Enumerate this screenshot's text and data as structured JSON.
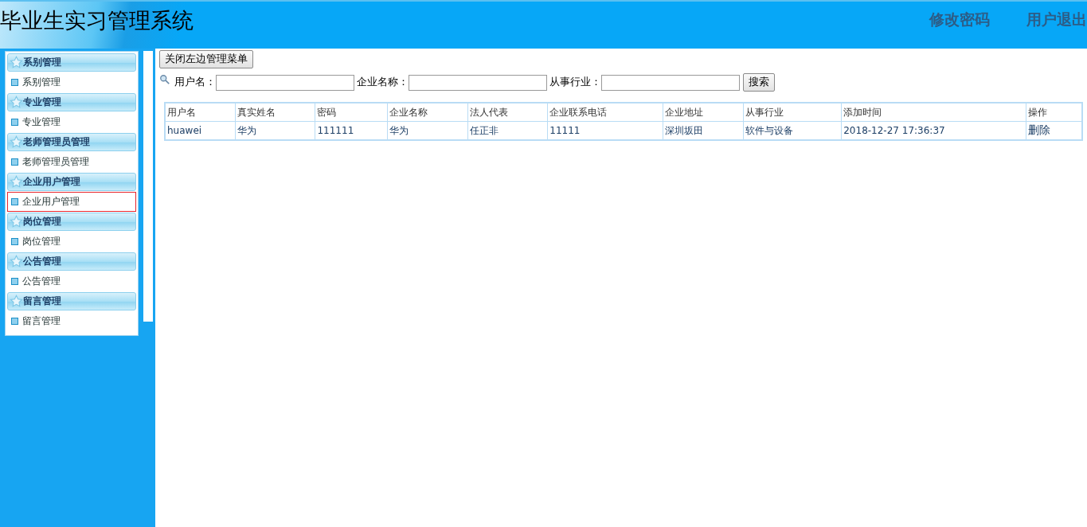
{
  "header": {
    "title": "毕业生实习管理系统",
    "links": [
      "修改密码",
      "用户退出"
    ]
  },
  "sidebar": {
    "sections": [
      {
        "title": "系别管理",
        "items": [
          {
            "label": "系别管理",
            "selected": false
          }
        ]
      },
      {
        "title": "专业管理",
        "items": [
          {
            "label": "专业管理",
            "selected": false
          }
        ]
      },
      {
        "title": "老师管理员管理",
        "items": [
          {
            "label": "老师管理员管理",
            "selected": false
          }
        ]
      },
      {
        "title": "企业用户管理",
        "items": [
          {
            "label": "企业用户管理",
            "selected": true
          }
        ]
      },
      {
        "title": "岗位管理",
        "items": [
          {
            "label": "岗位管理",
            "selected": false
          }
        ]
      },
      {
        "title": "公告管理",
        "items": [
          {
            "label": "公告管理",
            "selected": false
          }
        ]
      },
      {
        "title": "留言管理",
        "items": [
          {
            "label": "留言管理",
            "selected": false
          }
        ]
      }
    ]
  },
  "toggle_button": "关闭左边管理菜单",
  "search": {
    "fields": [
      {
        "label": "用户名："
      },
      {
        "label": "企业名称："
      },
      {
        "label": "从事行业："
      }
    ],
    "button": "搜索"
  },
  "table": {
    "columns": [
      "用户名",
      "真实姓名",
      "密码",
      "企业名称",
      "法人代表",
      "企业联系电话",
      "企业地址",
      "从事行业",
      "添加时间",
      "操作"
    ],
    "rows": [
      {
        "cells": [
          "huawei",
          "华为",
          "111111",
          "华为",
          "任正非",
          "11111",
          "深圳坂田",
          "软件与设备",
          "2018-12-27 17:36:37"
        ],
        "action": "删除"
      }
    ]
  }
}
